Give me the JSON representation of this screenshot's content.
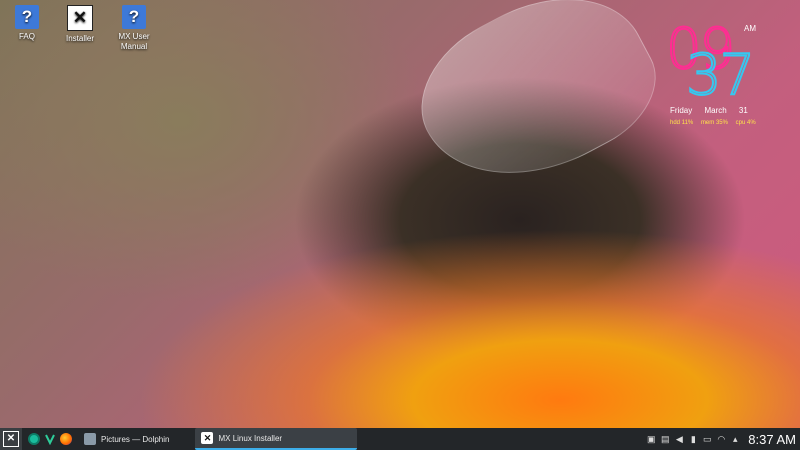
{
  "desktop": {
    "icons": [
      {
        "label": "FAQ",
        "icon": "help-icon"
      },
      {
        "label": "Installer",
        "icon": "mx-installer-icon"
      },
      {
        "label": "MX User Manual",
        "icon": "help-icon"
      }
    ],
    "help_glyph": "?",
    "mx_glyph": "✕"
  },
  "clock_widget": {
    "hours": "09",
    "minutes": "37",
    "ampm": "AM",
    "day": "Friday",
    "date": "March 31",
    "stats": [
      {
        "label": "hdd",
        "value": "11%"
      },
      {
        "label": "mem",
        "value": "35%"
      },
      {
        "label": "cpu",
        "value": "4%"
      }
    ]
  },
  "taskbar": {
    "tasks": [
      {
        "label": "Pictures — Dolphin",
        "icon": "dolphin-icon"
      },
      {
        "label": "MX Linux Installer",
        "icon": "mx-installer-icon"
      }
    ],
    "clock": "8:37 AM",
    "tray_icons": [
      "notes-icon",
      "clipboard-icon",
      "volume-icon",
      "battery-icon",
      "display-icon",
      "wifi-icon",
      "expand-tray-icon"
    ]
  },
  "colors": {
    "clock_hours": "#ff2d92",
    "clock_minutes": "#35c8f0",
    "stats_text": "#ffe14a",
    "taskbar_bg": "#232629",
    "active_task_accent": "#3daee9"
  }
}
